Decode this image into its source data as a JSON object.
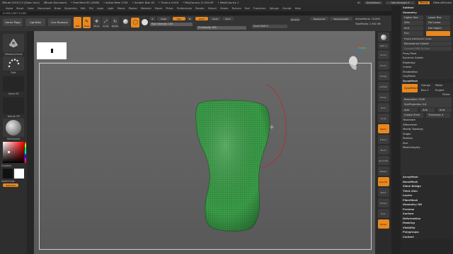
{
  "titlebar": {
    "app": "ZBrush 2023.2.2 [Tyson Vurr]",
    "document": "ZBrush Document",
    "free_mem": "• Free Mem 82.126GB",
    "active_mem": "• Active Mem 1745",
    "scratch_disk": "• Scratch Disk 45",
    "timer": "• Timer ▸ 0.016",
    "poly_count": "• PolyCount ▸ 11.054 KP",
    "mesh_count": "• MeshCount ▸ 1",
    "ac": "AC",
    "quicksave": "QuickSave",
    "see_through": "See-through 0",
    "menus": "Menus",
    "default_script": "DefaultZScript"
  },
  "menubar": [
    "Alpha",
    "Brush",
    "Color",
    "Document",
    "Draw",
    "Dynamics",
    "Edit",
    "File",
    "Layer",
    "Light",
    "Macro",
    "Marker",
    "Material",
    "Movie",
    "Picker",
    "Preferences",
    "Render",
    "Stencil",
    "Stroke",
    "Texture",
    "Tool",
    "Transform",
    "Zplugin",
    "Zscript",
    "Help"
  ],
  "coords": "0.093,0.857,0.083",
  "toptools": {
    "home_page": "Home Page",
    "lightbox": "LightBox",
    "live_boolean": "Live Boolean",
    "edit": "Edit",
    "draw": "Draw",
    "move": "Move",
    "scale": "Scale",
    "rotate": "Rotate",
    "a_label": "A",
    "mrgb": "Mrgb",
    "rgb": "Rgb",
    "m": "M",
    "zadd": "Zadd",
    "zsub": "Zsub",
    "zcut": "Zcut",
    "rgb_intensity": "Rgb Intensity 100",
    "z_intensity": "Z Intensity 100",
    "focal_shift": "Focal Shift 0",
    "draw_size": "Draw Size 25.05439",
    "replay_last": "ReplayLast",
    "replay_last_rel": "ReplayLastRel",
    "adjust_last": "AdjustLast 1",
    "active_points": "ActivePoints: 10,800",
    "total_points": "TotalPoints: 2.941 Mil",
    "dynamic": "Dynamic",
    "rgb_intensity_value": 100,
    "z_intensity_value": 100,
    "focal_shift_value": 0,
    "draw_size_value": 25.05439
  },
  "leftshelf": {
    "brush_label": "ZModeler/Hinits",
    "dots_label": "Dots",
    "alpha_label": "Alpha Off",
    "texture_label": "Texture Off",
    "material_label": "SkinShade4",
    "gradient_label": "Gradient",
    "switch_color": "SwitchColor",
    "alternate": "Alternate"
  },
  "rightshelf": {
    "spix": "SPix 3",
    "scroll": "Scroll",
    "zoom": "Zoom",
    "actual": "Actual",
    "aahalf": "AAHalf",
    "persp": "Persp",
    "floor": "Floor",
    "local": "Local",
    "gizmo": "Gizmo",
    "frame": "Frame",
    "move": "Move",
    "zoom3d": "Zoom3D",
    "rotate": "Rotate",
    "line_fill": "Line Fill",
    "polyf": "PolyF",
    "transp": "Transp",
    "solo": "Solo",
    "xpose": "Xpose"
  },
  "panel": {
    "subtool": "Subtool",
    "geometry": "Geometry",
    "higher_res": "Higher Res",
    "lower_res": "Lower Res",
    "sdiv": "SDiv",
    "del_lower": "Del Lower",
    "del_higher": "Del Higher",
    "smt": "Smt",
    "suv": "Suv",
    "freeze_subdiv": "Freeze SubDivision Levels",
    "reconstruct_subdiv": "Reconstruct Subdiv",
    "convert_bpr": "Convert BPR To Geo",
    "items": [
      "Proxy Pose",
      "Dynamic Subdiv",
      "EdgeLoop",
      "Crease",
      "ShadowBox",
      "ClayPolish"
    ],
    "dynamesh": "DynaMesh",
    "dynamesh_btn": "DynaMesh",
    "groups": "Groups",
    "polish": "Polish",
    "blur": "Blur 2",
    "project": "Project",
    "picker": "Picker",
    "resolution": "Resolution 1528",
    "subprojection": "SubProjection 0.6",
    "add": "Add",
    "sub": "Sub",
    "and": "And",
    "create_shell": "Create Shell",
    "thickness": "Thickness 4",
    "items2": [
      "Tessimate",
      "ZRemesher",
      "Modify Topology",
      "Stager",
      "Position",
      "Size",
      "MeshIntegrity"
    ],
    "resolution_value": 1528,
    "subprojection_value": 0.6,
    "thickness_value": 4
  },
  "subpanel": [
    "ArrayMesh",
    "NanoMesh",
    "Slime Bridge",
    "Thick Skin",
    "Layers",
    "FiberMesh",
    "Geometry HD",
    "Preview",
    "Surface",
    "Deformation",
    "Masking",
    "Visibility",
    "Polygroups",
    "Contact"
  ],
  "colors": {
    "accent": "#e8881f",
    "mesh": "#3fae4d",
    "curve": "#c8242a"
  }
}
